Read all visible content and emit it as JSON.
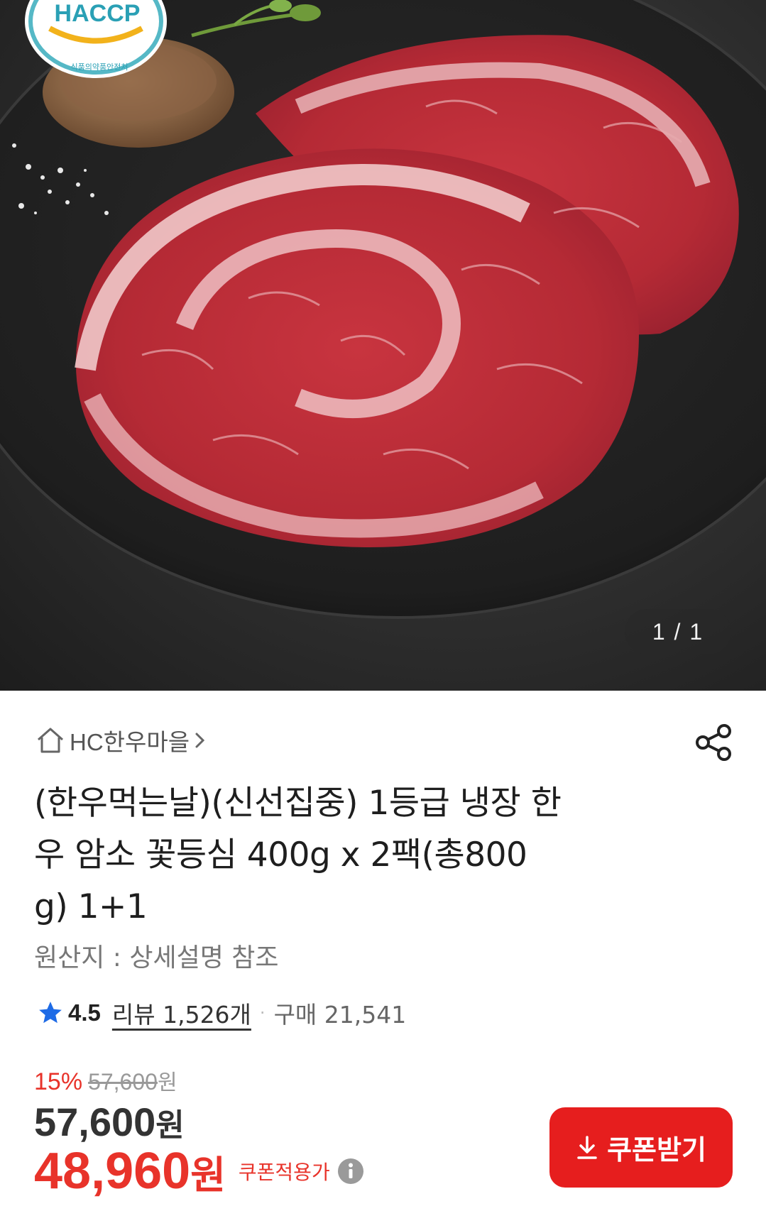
{
  "gallery": {
    "counter": "1 / 1",
    "badge_text": "HACCP",
    "badge_subtext": "식품의약품안전처"
  },
  "store": {
    "name": "HC한우마을",
    "home_icon": "home-icon",
    "chevron_icon": "chevron-right-icon",
    "share_icon": "share-icon"
  },
  "product": {
    "title_lines": [
      "(한우먹는날)(신선집중) 1등급 냉장 한",
      "우 암소 꽃등심 400g x 2팩(총800",
      "g) 1+1"
    ],
    "origin": "원산지 : 상세설명 참조"
  },
  "rating": {
    "score": "4.5",
    "reviews": "리뷰 1,526개",
    "separator": "·",
    "purchases": "구매 21,541"
  },
  "price": {
    "discount_pct": "15%",
    "original": "57,600",
    "original_won": "원",
    "sale": "57,600",
    "sale_won": "원",
    "coupon_price": "48,960",
    "coupon_won": "원",
    "coupon_label": "쿠폰적용가"
  },
  "coupon_button": {
    "label": "쿠폰받기"
  },
  "colors": {
    "accent_red": "#e8332a",
    "button_red": "#e61e1e",
    "star_blue": "#1e6be6"
  }
}
